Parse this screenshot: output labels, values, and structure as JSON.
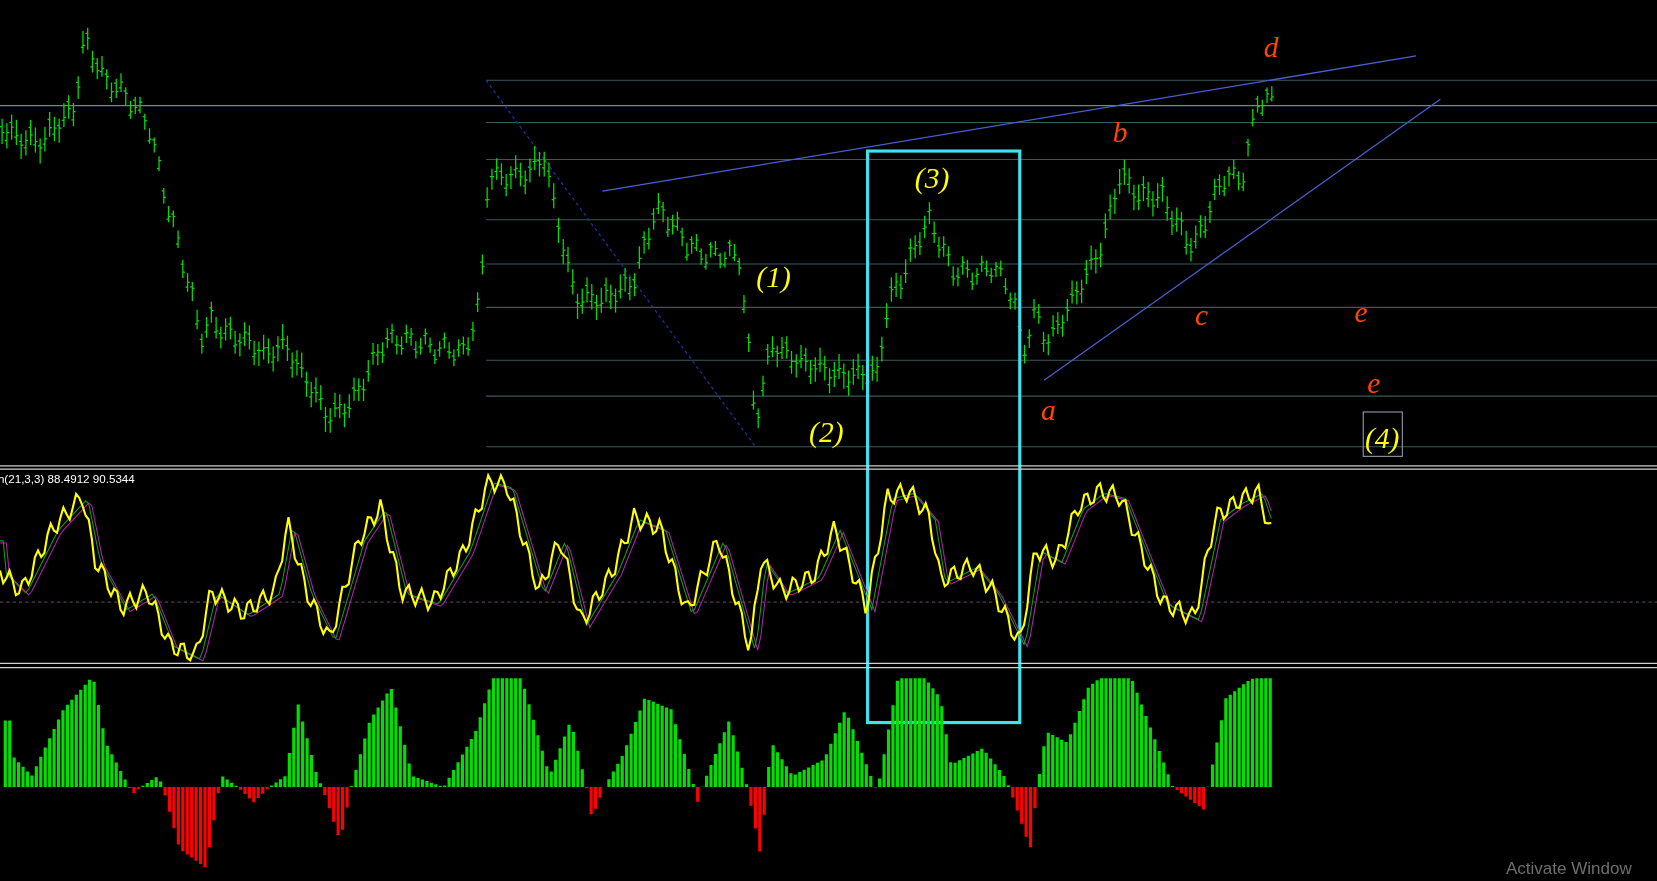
{
  "price_chart": {
    "wave_labels": [
      {
        "text": "(1)",
        "color": "#ffff00",
        "boxed": false
      },
      {
        "text": "(2)",
        "color": "#ffff00",
        "boxed": false
      },
      {
        "text": "(3)",
        "color": "#ffff00",
        "boxed": false
      },
      {
        "text": "(4)",
        "color": "#ffff00",
        "boxed": true
      },
      {
        "text": "a",
        "color": "#ff4500",
        "boxed": false
      },
      {
        "text": "b",
        "color": "#ff4500",
        "boxed": false
      },
      {
        "text": "c",
        "color": "#ff4500",
        "boxed": false
      },
      {
        "text": "d",
        "color": "#ff4500",
        "boxed": false
      },
      {
        "text": "e",
        "color": "#ff4500",
        "boxed": false
      },
      {
        "text": "e",
        "color": "#ff4500",
        "boxed": false
      }
    ]
  },
  "stochastic": {
    "label": "h(21,3,3) 88.4912 90.5344"
  },
  "system_notice": {
    "text": "Activate Window"
  }
}
